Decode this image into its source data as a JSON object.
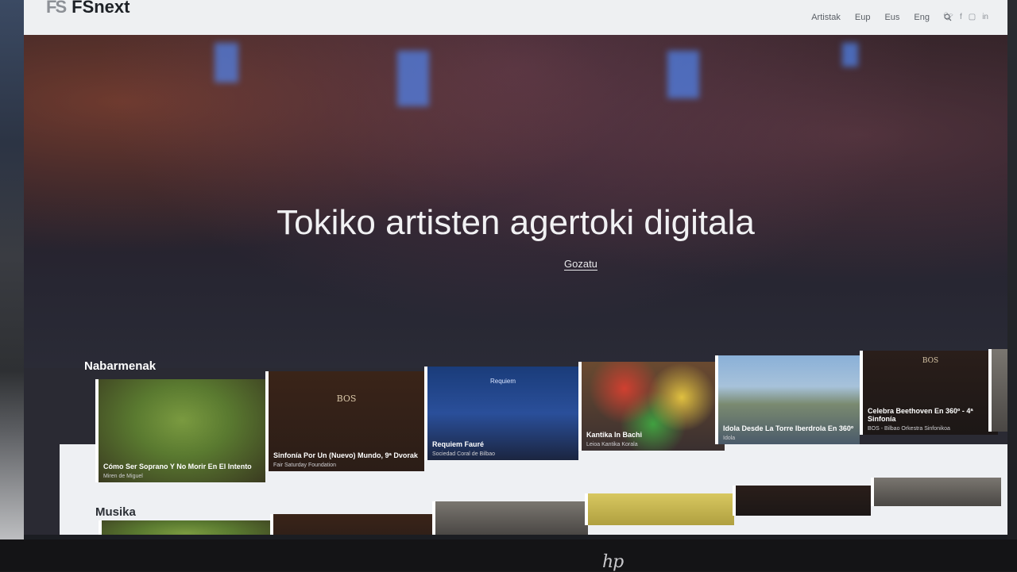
{
  "header": {
    "logo_mark": "FS",
    "logo_text": "FSnext",
    "nav": [
      "Artistak",
      "Eup",
      "Eus",
      "Eng"
    ],
    "social": [
      "twitter-icon",
      "facebook-icon",
      "instagram-icon",
      "linkedin-icon"
    ]
  },
  "hero": {
    "title": "Tokiko artisten agertoki digitala",
    "cta": "Gozatu"
  },
  "sections": [
    {
      "title": "Nabarmenak",
      "cards": [
        {
          "title": "Cómo Ser Soprano Y No Morir En El Intento",
          "subtitle": "Miren de Miguel"
        },
        {
          "title": "Sinfonía Por Un (Nuevo) Mundo, 9ª Dvorak",
          "subtitle": "Fair Saturday Foundation"
        },
        {
          "title": "Requiem Fauré",
          "subtitle": "Sociedad Coral de Bilbao"
        },
        {
          "title": "Kantika In Bachi",
          "subtitle": "Leioa Kantika Korala"
        },
        {
          "title": "Idola Desde La Torre Iberdrola En 360º",
          "subtitle": "Idola"
        },
        {
          "title": "Celebra Beethoven En 360º - 4ª Sinfonía",
          "subtitle": "BOS - Bilbao Orkestra Sinfonikoa"
        }
      ]
    },
    {
      "title": "Musika"
    }
  ],
  "thumb_text": {
    "bos": "BOS",
    "requiem": "Requiem"
  },
  "monitor": {
    "brand": "hp"
  }
}
